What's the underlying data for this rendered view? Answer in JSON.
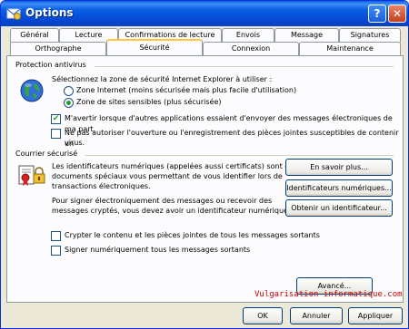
{
  "window": {
    "title": "Options",
    "help_button": "?",
    "close_button": "✕"
  },
  "tabs_row1": [
    {
      "label": "Général"
    },
    {
      "label": "Lecture"
    },
    {
      "label": "Confirmations de lecture"
    },
    {
      "label": "Envois"
    },
    {
      "label": "Message"
    },
    {
      "label": "Signatures"
    }
  ],
  "tabs_row2": [
    {
      "label": "Orthographe"
    },
    {
      "label": "Sécurité",
      "selected": true
    },
    {
      "label": "Connexion"
    },
    {
      "label": "Maintenance"
    }
  ],
  "antivirus": {
    "title": "Protection antivirus",
    "select_zone_label": "Sélectionnez la zone de sécurité Internet Explorer à utiliser :",
    "radio_internet": "Zone Internet (moins sécurisée mais plus facile d'utilisation)",
    "radio_restricted": "Zone de sites sensibles (plus sécurisée)",
    "check_warn": "M'avertir lorsque d'autres applications essaient d'envoyer des messages électroniques de ma part.",
    "check_block_line1": "Ne pas autoriser l'ouverture ou l'enregistrement des pièces jointes susceptibles de contenir un",
    "check_block_line2": "virus.",
    "radio_internet_checked": false,
    "radio_restricted_checked": true,
    "check_warn_checked": true,
    "check_block_checked": false
  },
  "secure_mail": {
    "title": "Courrier sécurisé",
    "ids_text_line1": "Les identificateurs numériques (appelées aussi certificats) sont des",
    "ids_text_line2": "documents spéciaux vous permettant de vous identifier lors de",
    "ids_text_line3": "transactions électroniques.",
    "sign_text_line1": "Pour signer électroniquement des messages ou recevoir des",
    "sign_text_line2": "messages cryptés, vous devez avoir un identificateur numérique.",
    "btn_learn_more": "En savoir plus...",
    "btn_digital_ids": "Identificateurs numériques...",
    "btn_get_id": "Obtenir un identificateur...",
    "check_encrypt": "Crypter le contenu et les pièces jointes de tous les messages sortants",
    "check_sign": "Signer numériquement tous les messages sortants",
    "check_encrypt_checked": false,
    "check_sign_checked": false,
    "btn_advanced": "Avancé..."
  },
  "footer": {
    "ok": "OK",
    "cancel": "Annuler",
    "apply": "Appliquer"
  },
  "watermark": "Vulgarisation-informatique.com",
  "check_mark": "✔"
}
